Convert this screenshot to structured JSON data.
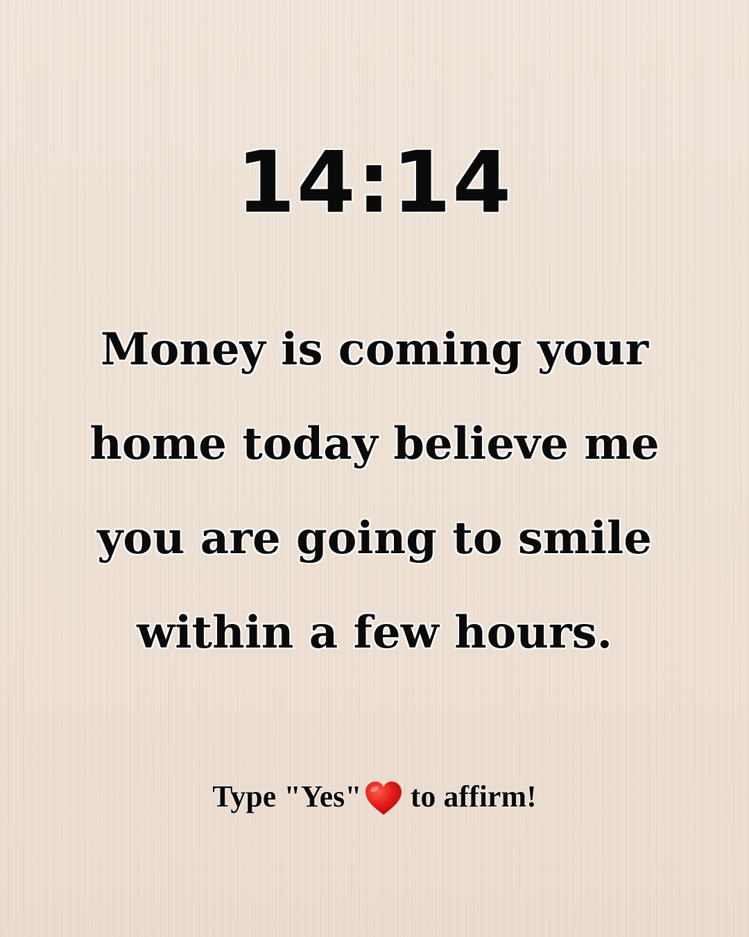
{
  "time": "14:14",
  "message": {
    "lines": [
      "Money is coming your",
      "home today believe me",
      "you are going to smile",
      "within a few hours."
    ]
  },
  "cta": {
    "before_heart": "Type \"Yes\"",
    "heart_icon": "red-heart-icon",
    "heart_color": "#e31b1b",
    "after_heart": "to affirm!"
  },
  "colors": {
    "background": "#efe3d7",
    "text": "#0a0a0a"
  }
}
